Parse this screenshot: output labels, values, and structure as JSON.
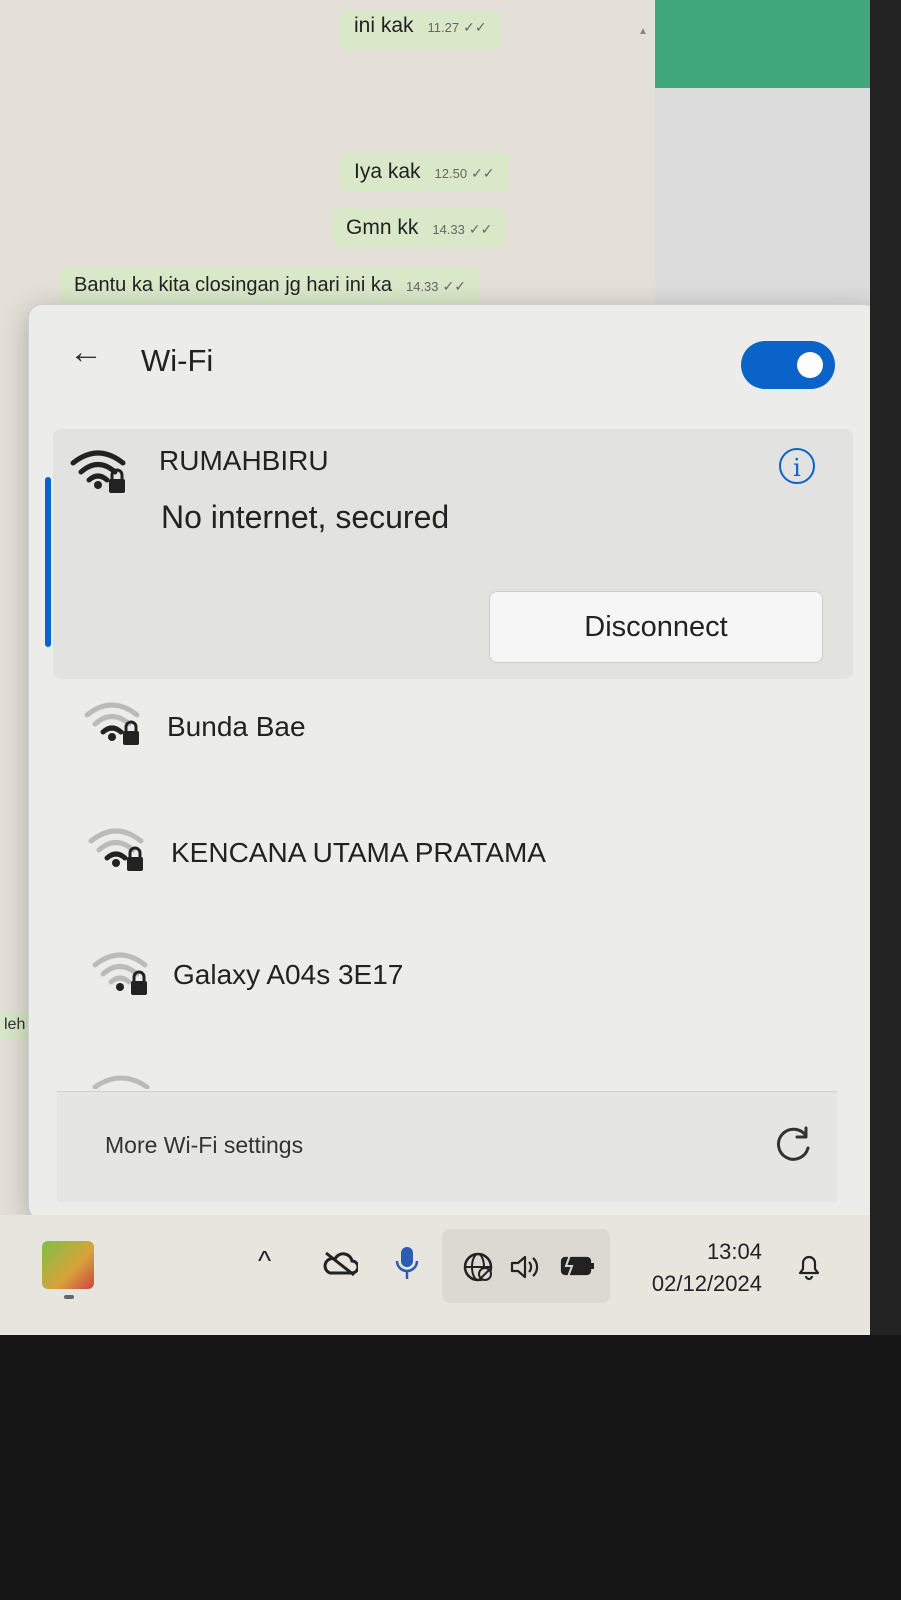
{
  "chat": {
    "messages": [
      {
        "text": "ini kak",
        "time": "11.27",
        "ticks": "✓✓"
      },
      {
        "text": "Iya kak",
        "time": "12.50",
        "ticks": "✓✓"
      },
      {
        "text": "Gmn kk",
        "time": "14.33",
        "ticks": "✓✓"
      },
      {
        "text": "Bantu ka kita closingan jg hari ini ka",
        "time": "14.33",
        "ticks": "✓✓"
      }
    ],
    "side_text": "leh sa"
  },
  "wifi": {
    "title": "Wi-Fi",
    "toggle_on": true,
    "active": {
      "name": "RUMAHBIRU",
      "status": "No internet, secured",
      "disconnect_label": "Disconnect"
    },
    "networks": [
      {
        "name": "Bunda Bae"
      },
      {
        "name": "KENCANA UTAMA PRATAMA"
      },
      {
        "name": "Galaxy A04s 3E17"
      }
    ],
    "more_settings": "More Wi-Fi settings"
  },
  "taskbar": {
    "time": "13:04",
    "date": "02/12/2024"
  },
  "colors": {
    "accent": "#0a63c9",
    "chat_bubble": "#d8e8c8",
    "header_green": "#3fa77a"
  }
}
